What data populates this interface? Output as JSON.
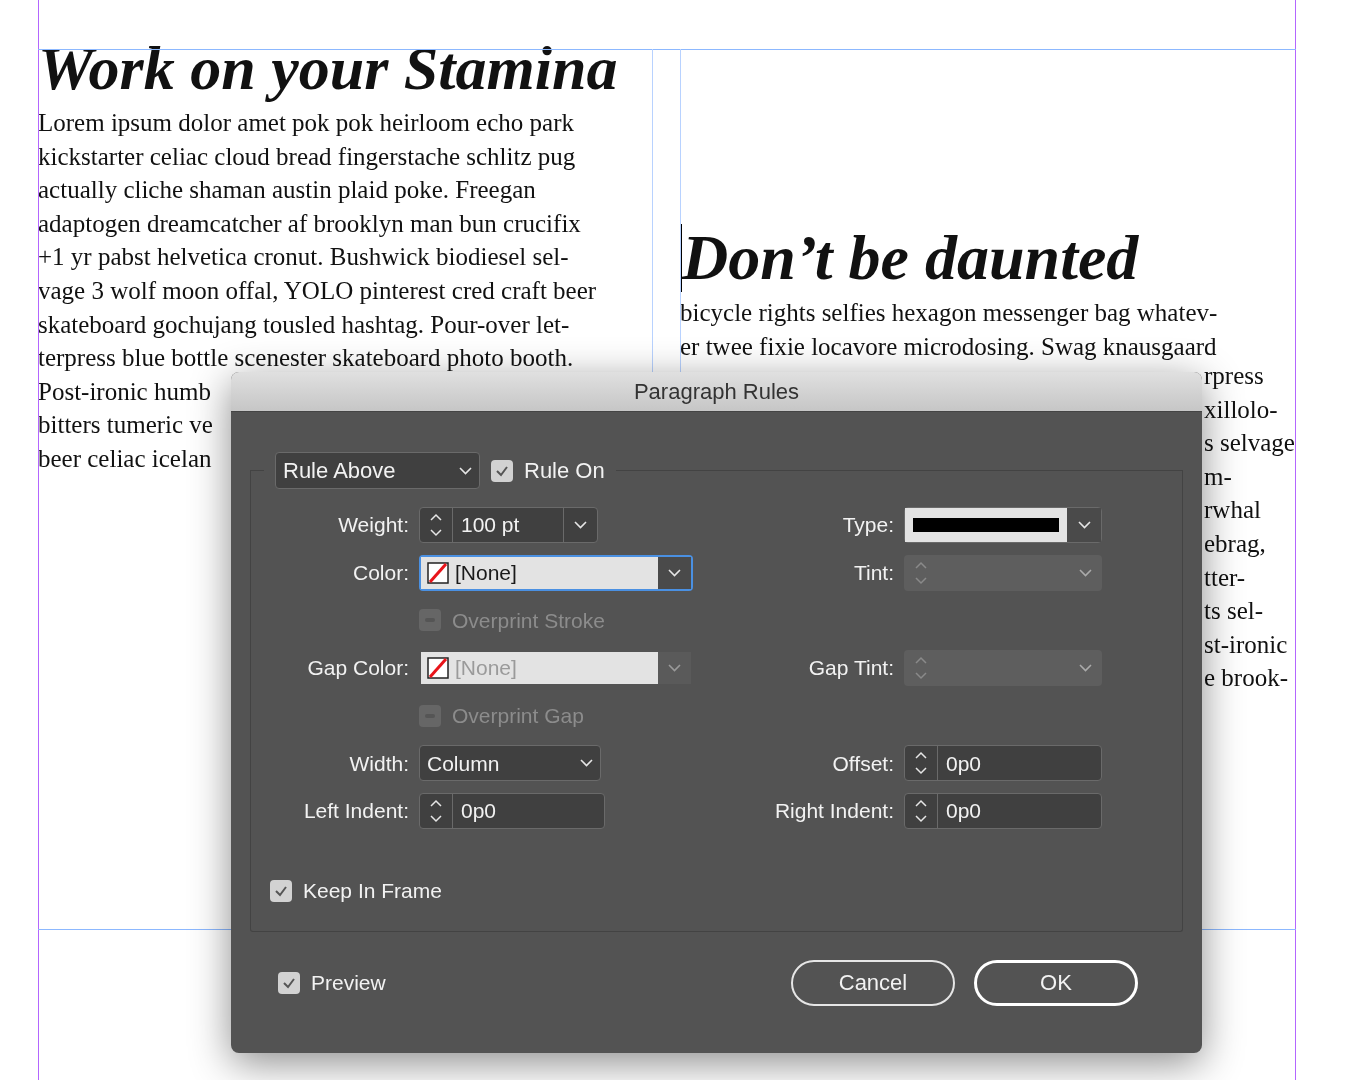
{
  "document": {
    "left_column": {
      "heading": "Work on your Stamina",
      "lines": [
        "Lorem ipsum dolor amet pok pok heirloom echo park",
        "kickstarter celiac cloud bread fingerstache schlitz pug",
        "actually cliche shaman austin plaid poke. Freegan",
        "adaptogen dreamcatcher af brooklyn man bun crucifix",
        "+1 yr pabst helvetica cronut. Bushwick biodiesel sel-",
        "vage 3 wolf moon offal, YOLO pinterest cred craft beer",
        "skateboard gochujang tousled hashtag. Pour-over let-",
        "terpress blue bottle scenester skateboard photo booth.",
        "Post-ironic humb",
        "bitters tumeric ve",
        "beer celiac icelan"
      ]
    },
    "right_column": {
      "heading": "Don’t be daunted",
      "text_cursor": true,
      "lines": [
        "bicycle rights selfies hexagon messenger bag whatev-",
        "er twee fixie locavore microdosing. Swag knausgaard"
      ],
      "fragments": [
        "rpress",
        "xillolo-",
        "s selvage",
        "m-",
        "rwhal",
        "ebrag,",
        "tter-",
        "ts sel-",
        "st-ironic",
        "e brook-"
      ]
    }
  },
  "dialog": {
    "title": "Paragraph Rules",
    "rule_select": {
      "value": "Rule Above"
    },
    "rule_on": {
      "label": "Rule On",
      "checked": true
    },
    "rows": [
      {
        "left": {
          "kind": "spinner-select",
          "label": "Weight:",
          "value": "100 pt",
          "disabled": false
        },
        "right": {
          "kind": "line-type",
          "label": "Type:"
        }
      },
      {
        "left": {
          "kind": "color",
          "label": "Color:",
          "value": "[None]",
          "disabled": false,
          "focused": true
        },
        "right": {
          "kind": "spinner-select",
          "label": "Tint:",
          "disabled": true
        }
      },
      {
        "left": {
          "kind": "checkbox",
          "label": "Overprint Stroke",
          "checked": false,
          "disabled": true
        }
      },
      {
        "left": {
          "kind": "color",
          "label": "Gap Color:",
          "value": "[None]",
          "disabled": true,
          "focused": false
        },
        "right": {
          "kind": "spinner-select",
          "label": "Gap Tint:",
          "disabled": true
        }
      },
      {
        "left": {
          "kind": "checkbox",
          "label": "Overprint Gap",
          "checked": false,
          "disabled": true
        }
      },
      {
        "left": {
          "kind": "select",
          "label": "Width:",
          "value": "Column"
        },
        "right": {
          "kind": "spinner",
          "label": "Offset:",
          "value": "0p0"
        }
      },
      {
        "left": {
          "kind": "spinner",
          "label": "Left Indent:",
          "value": "0p0"
        },
        "right": {
          "kind": "spinner",
          "label": "Right Indent:",
          "value": "0p0"
        }
      }
    ],
    "keep_in_frame": {
      "label": "Keep In Frame",
      "checked": true
    },
    "preview": {
      "label": "Preview",
      "checked": true
    },
    "buttons": [
      {
        "label": "Cancel",
        "default": false
      },
      {
        "label": "OK",
        "default": true
      }
    ]
  }
}
